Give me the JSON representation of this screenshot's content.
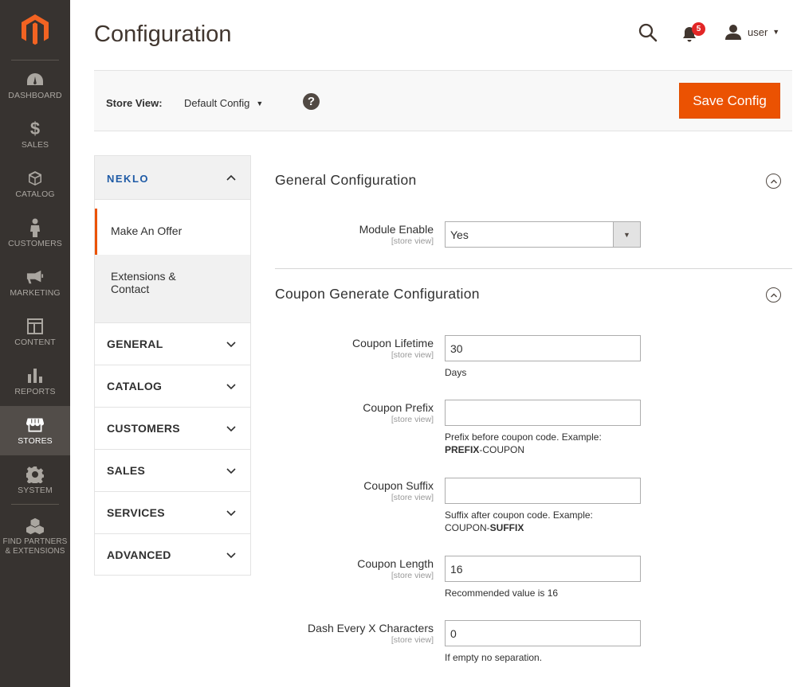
{
  "nav": {
    "items": [
      {
        "label": "DASHBOARD",
        "icon": "dashboard-icon"
      },
      {
        "label": "SALES",
        "icon": "dollar-icon"
      },
      {
        "label": "CATALOG",
        "icon": "box-icon"
      },
      {
        "label": "CUSTOMERS",
        "icon": "person-icon"
      },
      {
        "label": "MARKETING",
        "icon": "megaphone-icon"
      },
      {
        "label": "CONTENT",
        "icon": "layout-icon"
      },
      {
        "label": "REPORTS",
        "icon": "bar-chart-icon"
      },
      {
        "label": "STORES",
        "icon": "store-icon"
      },
      {
        "label": "SYSTEM",
        "icon": "gear-icon"
      },
      {
        "label": "FIND PARTNERS & EXTENSIONS",
        "icon": "cubes-icon"
      }
    ],
    "active": "STORES"
  },
  "header": {
    "title": "Configuration",
    "notification_count": "5",
    "user": "user"
  },
  "store_bar": {
    "label": "Store View:",
    "value": "Default Config",
    "help": "?",
    "save_label": "Save Config"
  },
  "tabs": {
    "vendor": "NEKLO",
    "sub_items": [
      "Make An Offer",
      "Extensions & Contact"
    ],
    "groups": [
      "GENERAL",
      "CATALOG",
      "CUSTOMERS",
      "SALES",
      "SERVICES",
      "ADVANCED"
    ]
  },
  "sections": {
    "general": {
      "title": "General Configuration",
      "module_enable": {
        "label": "Module Enable",
        "scope": "[store view]",
        "value": "Yes"
      }
    },
    "coupon": {
      "title": "Coupon Generate Configuration",
      "lifetime": {
        "label": "Coupon Lifetime",
        "scope": "[store view]",
        "value": "30",
        "note": "Days"
      },
      "prefix": {
        "label": "Coupon Prefix",
        "scope": "[store view]",
        "value": "",
        "note": "Prefix before coupon code. Example:",
        "example_bold": "PREFIX",
        "example_rest": "-COUPON"
      },
      "suffix": {
        "label": "Coupon Suffix",
        "scope": "[store view]",
        "value": "",
        "note": "Suffix after coupon code. Example:",
        "example_rest": "COUPON-",
        "example_bold": "SUFFIX"
      },
      "length": {
        "label": "Coupon Length",
        "scope": "[store view]",
        "value": "16",
        "note": "Recommended value is 16"
      },
      "dash": {
        "label": "Dash Every X Characters",
        "scope": "[store view]",
        "value": "0",
        "note": "If empty no separation."
      }
    }
  },
  "colors": {
    "nav_bg": "#373330",
    "accent": "#eb5202",
    "badge": "#e22626",
    "vendor_blue": "#1f5ba6"
  }
}
